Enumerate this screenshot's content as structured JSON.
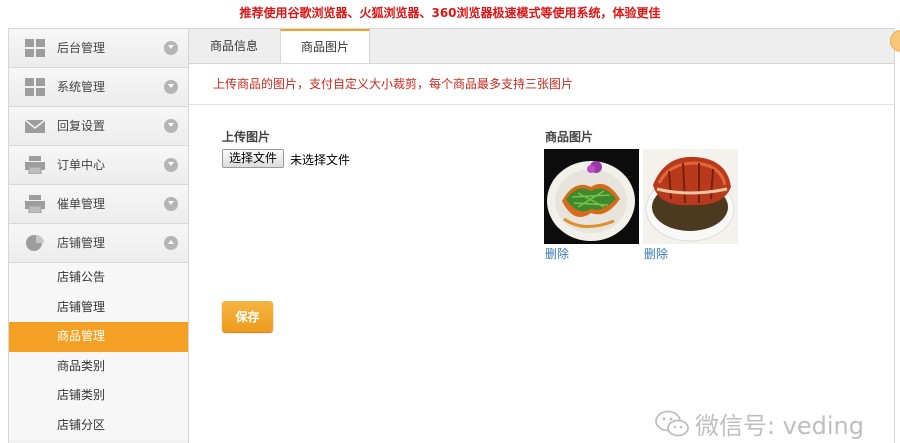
{
  "banner": "推荐使用谷歌浏览器、火狐浏览器、360浏览器极速模式等使用系统，体验更佳",
  "sidebar": {
    "menu": [
      {
        "label": "后台管理",
        "icon": "grid-icon",
        "expanded": false
      },
      {
        "label": "系统管理",
        "icon": "grid-icon",
        "expanded": false
      },
      {
        "label": "回复设置",
        "icon": "envelope-icon",
        "expanded": false
      },
      {
        "label": "订单中心",
        "icon": "printer-icon",
        "expanded": false
      },
      {
        "label": "催单管理",
        "icon": "printer-icon",
        "expanded": false
      },
      {
        "label": "店铺管理",
        "icon": "pie-chart-icon",
        "expanded": true
      }
    ],
    "submenu": [
      "店铺公告",
      "店铺管理",
      "商品管理",
      "商品类别",
      "店铺类别",
      "店铺分区"
    ],
    "active_submenu": "商品管理"
  },
  "tabs": [
    {
      "label": "商品信息",
      "active": false
    },
    {
      "label": "商品图片",
      "active": true
    }
  ],
  "notice": "上传商品的图片，支付自定义大小裁剪，每个商品最多支持三张图片",
  "upload": {
    "label": "上传图片",
    "button_label": "选择文件",
    "status": "未选择文件"
  },
  "images": {
    "label": "商品图片",
    "items": [
      {
        "alt": "stir-fried vegetable dish photo",
        "delete_label": "删除"
      },
      {
        "alt": "braised pork dish photo",
        "delete_label": "删除"
      }
    ]
  },
  "save_label": "保存",
  "watermark": "微信号: veding",
  "colors": {
    "accent": "#f3a025",
    "notice": "#d0281b",
    "banner": "#e01515",
    "link": "#3a79b9"
  }
}
